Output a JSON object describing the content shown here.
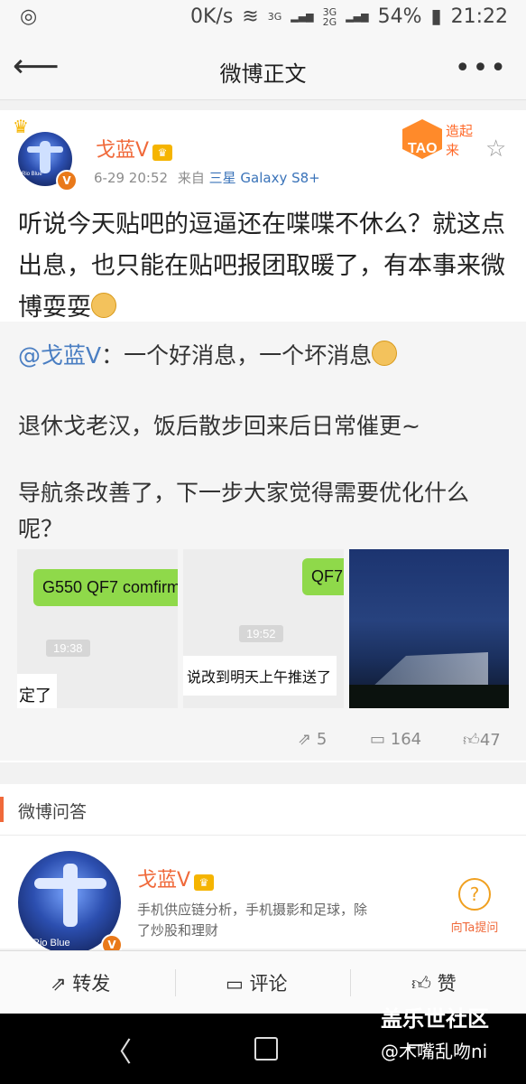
{
  "status_bar": {
    "speed": "0K/s",
    "net_3g_a": "3G",
    "net_3g_b": "3G",
    "net_2g": "2G",
    "battery": "54%",
    "time": "21:22"
  },
  "nav": {
    "title": "微博正文",
    "more": "•••"
  },
  "post": {
    "author": "戈蓝V",
    "date": "6-29 20:52",
    "from_label": "来自",
    "source": "三星 Galaxy S8+",
    "text": "听说今天贴吧的逗逼还在喋喋不休么？就这点出息，也只能在贴吧报团取暖了，有本事来微博耍耍",
    "badge_text": "造起来",
    "badge_tao": "TAO"
  },
  "repost": {
    "mention": "@戈蓝V",
    "line1": "：一个好消息，一个坏消息",
    "line2": "退休戈老汉，饭后散步回来后日常催更~",
    "line3": "导航条改善了，下一步大家觉得需要优化什么呢？",
    "images": [
      {
        "bubble": "G550 QF7 comfirm",
        "time": "19:38",
        "reply": "定了"
      },
      {
        "bubble": "QF7",
        "time": "19:52",
        "reply": "说改到明天上午推送了"
      },
      {
        "alt": "night sky building photo"
      }
    ],
    "actions": {
      "repost_count": "5",
      "comment_count": "164",
      "like_count": "47"
    }
  },
  "qa": {
    "section_title": "微博问答",
    "author": "戈蓝V",
    "desc_line1": "手机供应链分析，手机摄影和足球，除",
    "desc_line2": "了炒股和理财",
    "ask_label": "向Ta提问",
    "avatar_text": "Rio Blue"
  },
  "avatar_text": "Rio Blue",
  "toolbar": {
    "repost": "转发",
    "comment": "评论",
    "like": "赞"
  },
  "watermark": {
    "line1": "盖乐世社区",
    "line2": "@木嘴乱吻ni"
  },
  "colors": {
    "accent_orange": "#f0693a",
    "link_blue": "#4a7ec2",
    "chat_green": "#8fd94a"
  }
}
